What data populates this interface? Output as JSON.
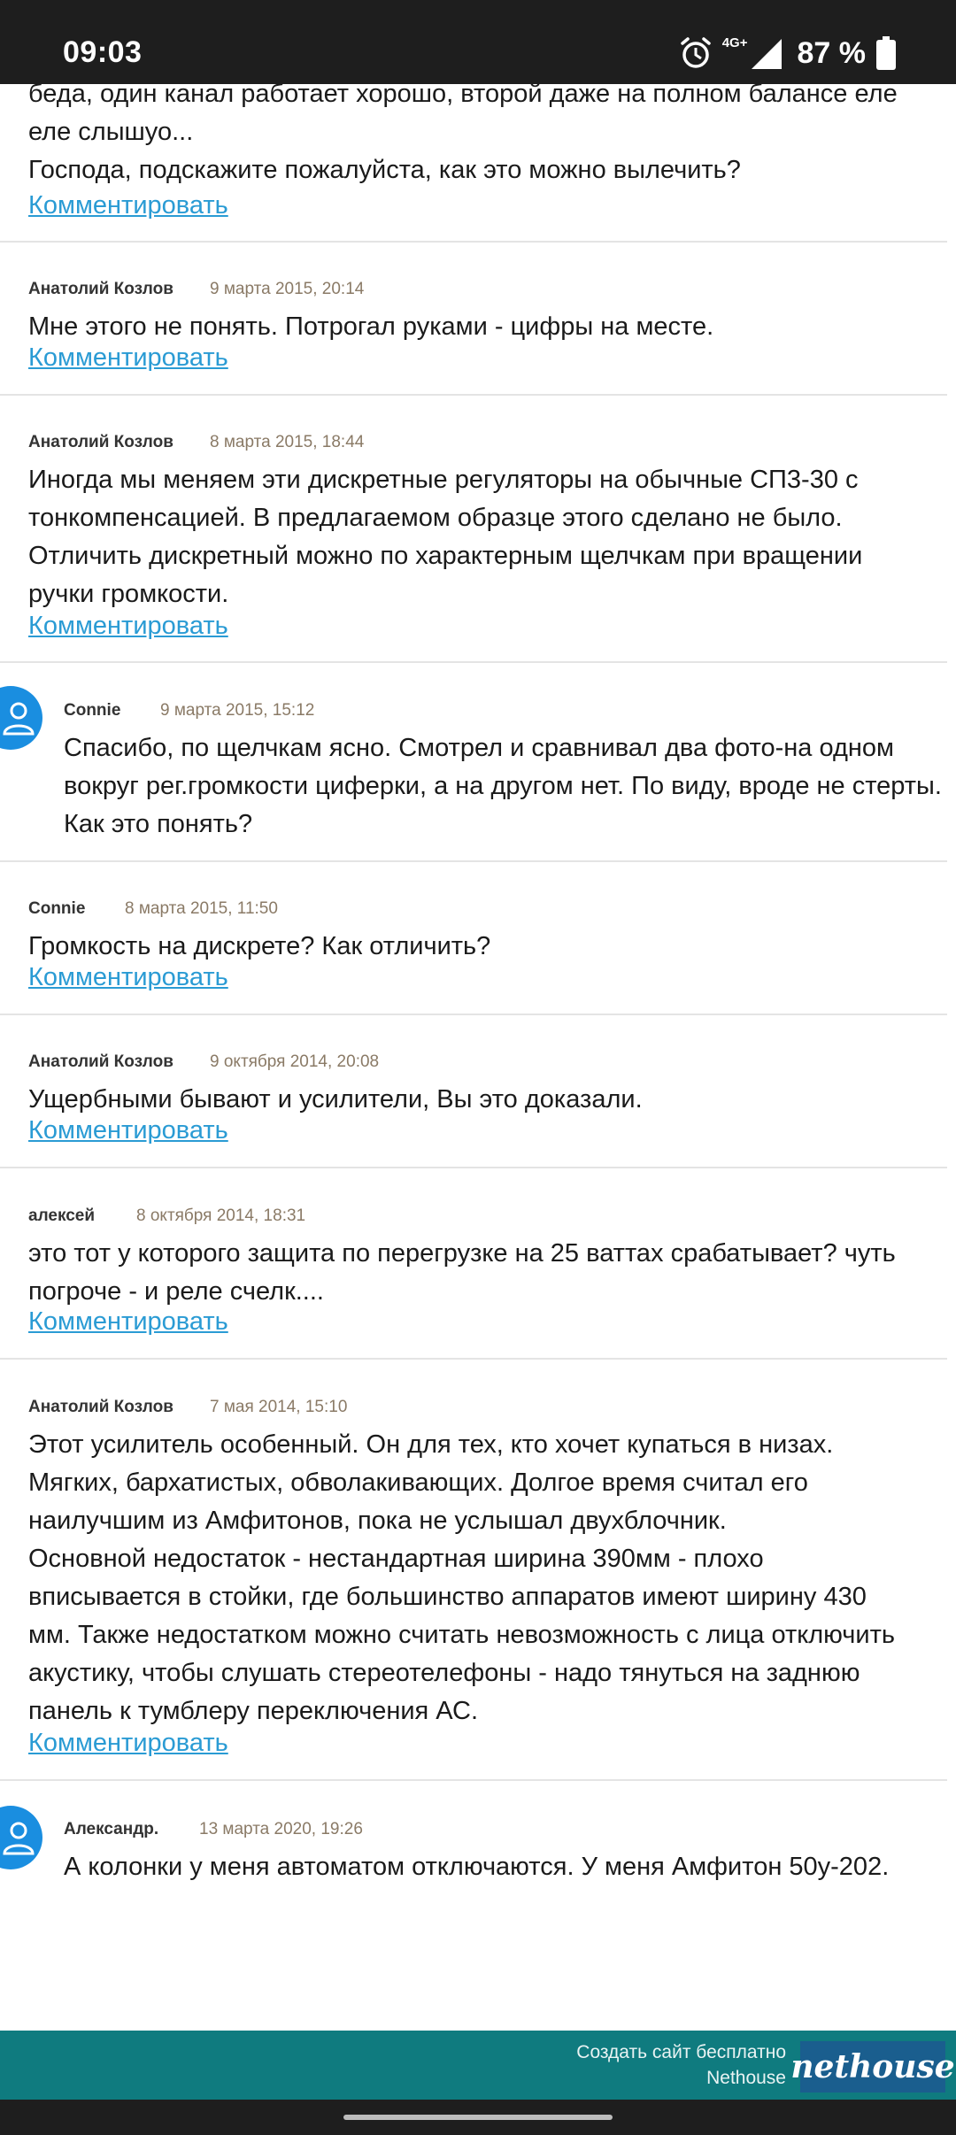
{
  "status_bar": {
    "time": "09:03",
    "network": "4G+",
    "battery": "87 %"
  },
  "entries": [
    {
      "author": "",
      "date": "",
      "lines": [
        "беда, один канал работает хорошо, второй даже на полном балансе еле",
        "еле слышуо...",
        "Господа, подскажите пожалуйста, как это можно вылечить?"
      ],
      "link": "Комментировать"
    },
    {
      "author": "Анатолий Козлов",
      "date": "9 марта 2015, 20:14",
      "lines": [
        "Мне этого не понять. Потрогал руками - цифры на месте."
      ],
      "link": "Комментировать"
    },
    {
      "author": "Анатолий Козлов",
      "date": "8 марта 2015, 18:44",
      "lines": [
        "Иногда мы меняем эти дискретные регуляторы на обычные СП3-30 с",
        "тонкомпенсацией. В предлагаемом образце этого сделано не было.",
        "Отличить дискретный можно по характерным щелчкам при вращении",
        "ручки громкости."
      ],
      "link": "Комментировать"
    },
    {
      "author": "Connie",
      "date": "9 марта 2015, 15:12",
      "lines": [
        "Спасибо, по щелчкам ясно. Смотрел и сравнивал два фото-на одном",
        "вокруг рег.громкости циферки, а на другом нет. По виду, вроде не стерты.",
        "Как это понять?"
      ],
      "link": ""
    },
    {
      "author": "Connie",
      "date": "8 марта 2015, 11:50",
      "lines": [
        "Громкость на дискрете? Как отличить?"
      ],
      "link": "Комментировать"
    },
    {
      "author": "Анатолий Козлов",
      "date": "9 октября 2014, 20:08",
      "lines": [
        "Ущербными бывают и усилители, Вы это доказали."
      ],
      "link": "Комментировать"
    },
    {
      "author": "алексей",
      "date": "8 октября 2014, 18:31",
      "lines": [
        "это тот у которого защита по перегрузке на 25 ваттах срабатывает? чуть",
        "погроче - и реле счелк...."
      ],
      "link": "Комментировать"
    },
    {
      "author": "Анатолий Козлов",
      "date": "7 мая 2014, 15:10",
      "lines": [
        "Этот усилитель особенный. Он для тех, кто хочет купаться в низах.",
        "Мягких, бархатистых, обволакивающих. Долгое время считал его",
        "наилучшим из Амфитонов, пока не услышал двухблочник.",
        "Основной недостаток - нестандартная ширина 390мм - плохо",
        "вписывается в стойки, где большинство аппаратов имеют ширину 430",
        "мм. Также недостатком можно считать невозможность с лица отключить",
        "акустику, чтобы слушать стереотелефоны - надо тянуться на заднюю",
        "панель к тумблеру переключения АС."
      ],
      "link": "Комментировать"
    },
    {
      "author": "Александр.",
      "date": "13 марта 2020, 19:26",
      "lines": [
        "А колонки у меня автоматом отключаются. У меня Амфитон 50у-202."
      ],
      "link": ""
    }
  ],
  "footer": {
    "line1": "Создать сайт бесплатно",
    "line2": "Nethouse",
    "logo": "nethouse"
  }
}
